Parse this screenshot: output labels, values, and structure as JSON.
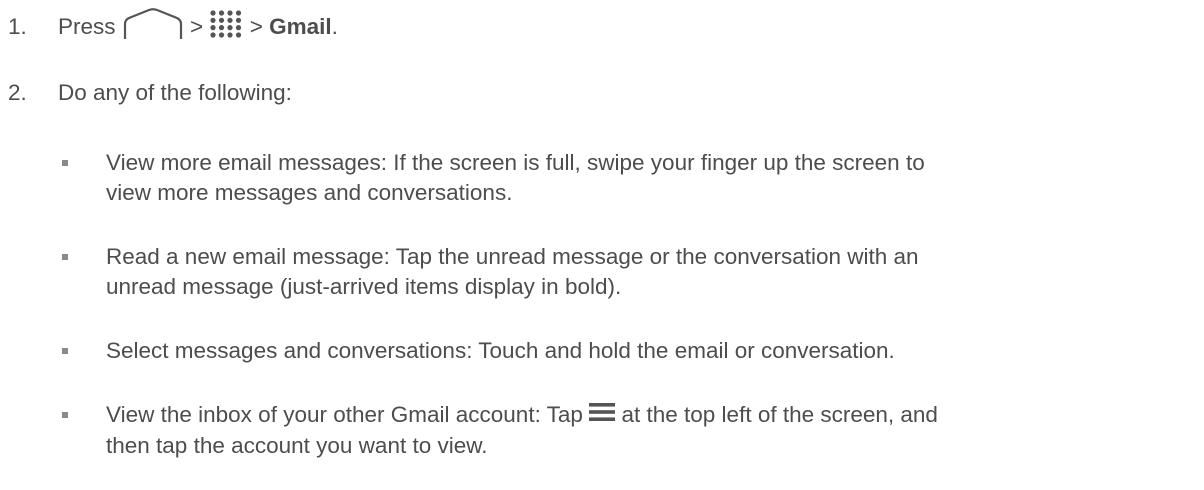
{
  "steps": [
    {
      "number": "1.",
      "prefix": "Press",
      "sep1": ">",
      "sep2": ">",
      "app": "Gmail",
      "suffix": ".",
      "icons": [
        "home-icon",
        "apps-grid-icon"
      ]
    },
    {
      "number": "2.",
      "text": "Do any of the following:"
    }
  ],
  "bullets": [
    {
      "line1": "View more email messages: If the screen is full, swipe your finger up the screen to",
      "line2": "view more messages and conversations."
    },
    {
      "line1": "Read a new email message: Tap the unread message or the conversation with an",
      "line2": "unread message (just-arrived items display in bold)."
    },
    {
      "line1": "Select messages and conversations: Touch and hold the email or conversation."
    },
    {
      "line1_before": "View the inbox of your other Gmail account: Tap",
      "line1_after": "at the top left of the screen, and",
      "line2": "then tap the account you want to view.",
      "icon": "menu-icon"
    }
  ],
  "colors": {
    "text": "#4d4d4d",
    "bullet": "#8a8a8a",
    "icon": "#555555"
  }
}
